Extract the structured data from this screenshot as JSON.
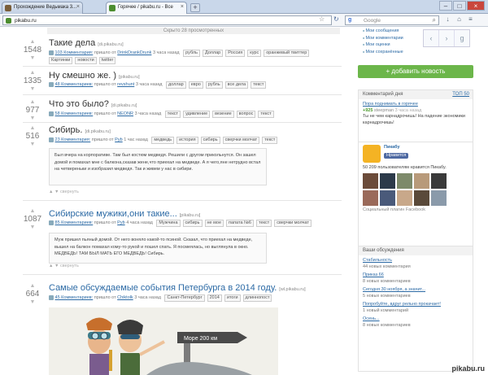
{
  "browser": {
    "tabs": [
      {
        "title": "Прохождение Ведьмака 3...",
        "active": false
      },
      {
        "title": "Горячее / pikabu.ru - Все",
        "active": true
      }
    ],
    "url": "pikabu.ru",
    "search_placeholder": "Google"
  },
  "page": {
    "top_strip": "Скрыто 28 просмотренных",
    "posts": [
      {
        "rating": "1548",
        "title": "Такие дела",
        "domain": "[di.pikabu.ru]",
        "comments": "103 Комментария:",
        "meta": "пришло от",
        "author": "DrinkDrankDrunk",
        "time": "3 часа назад",
        "tags": [
          "рубль",
          "Доллар",
          "Россия",
          "курс",
          "оранжевый твиттер"
        ],
        "tags2": [
          "Картинки",
          "новости",
          "twitter"
        ]
      },
      {
        "rating": "1335",
        "title": "Ну смешно же. )",
        "domain": "[pikabu.ru]",
        "comments": "48 Комментариев:",
        "meta": "пришло от",
        "author": "revshunt",
        "time": "3 часа назад",
        "tags": [
          "доллар",
          "евро",
          "рубль",
          "все дела",
          "текст"
        ]
      },
      {
        "rating": "977",
        "title": "Что это было?",
        "domain": "[di.pikabu.ru]",
        "comments": "58 Комментариев:",
        "meta": "пришло от",
        "author": "NEONR",
        "time": "3 часа назад",
        "tags": [
          "текст",
          "удивление",
          "везение",
          "вопрос",
          "текст"
        ]
      },
      {
        "rating": "516",
        "title": "Сибирь.",
        "domain": "[di.pikabu.ru]",
        "comments": "23 Комментария:",
        "meta": "пришло от",
        "author": "Pyb",
        "time": "1 час назад",
        "tags": [
          "медведь",
          "история",
          "сибирь",
          "сверчки молчат",
          "текст"
        ],
        "text": "Был вчера на корпоративе. Там был костюм медведя. Решили с другом прикольнутся. Он зашел домой и помахал мне с балкона,сказав жене,что приехал на медведе. А я чего,яне нетрудно встал на четвереньки и изобразил медведя. Так и живем у нас в сибири.",
        "collapse": "свернуть"
      },
      {
        "rating": "1087",
        "title": "Сибирские мужики,они такие...",
        "domain": "[pikabu.ru]",
        "comments": "85 Комментариев:",
        "meta": "пришло от",
        "author": "Pyb",
        "time": "4 часа назад",
        "tags": [
          "Мужчина",
          "сибирь",
          "не мое",
          "папата №6",
          "текст",
          "сверчки молчат"
        ],
        "text": "Муж пришел пьяный домой. От него воняло какой-то псиной. Сказал, что приехал на медведе, вышел на балкон помахал кому-то рукой и пошел спать. Я посмеялась, но выглянула в окно. МЕДВЕДЬ! ТАМ БЫЛ МАТЬ ЕГО МЕДВЕДЬ! Сибирь.",
        "collapse": "свернуть"
      },
      {
        "rating": "664",
        "title": "Самые обсуждаемые события Петербурга в 2014 году.",
        "domain": "[wl.pikabu.ru]",
        "comments": "45 Комментариев:",
        "meta": "пришло от",
        "author": "Chiktolk",
        "time": "3 часа назад",
        "tags": [
          "Санкт-Петербург",
          "2014",
          "итоги",
          "длиннопост"
        ],
        "image_sign": "Море 200 км"
      }
    ]
  },
  "sidebar": {
    "popup_links": [
      "Мои сообщения",
      "Мои комментарии",
      "Мои оценки",
      "Мои сохранённые"
    ],
    "add_button": "+ добавить новость",
    "comment_day": {
      "title": "Комментарий дня",
      "top": "ТОП 50",
      "link": "Пора поднимать в горячее",
      "score": "+925",
      "user": "steepman",
      "time": "3 часа назад",
      "text": "Ты не чем карнадрочишь! На падение экономики карнадрочишь!"
    },
    "fb": {
      "name": "Пикабу",
      "like": "Нравится",
      "count": "50 209 пользователям нравится Пикабу.",
      "plugin": "Социальный плагин Facebook"
    },
    "discussions": {
      "title": "Ваши обсуждения",
      "items": [
        {
          "title": "Стабильность",
          "sub": "44 новых комментария"
        },
        {
          "title": "Приказ 66",
          "sub": "8 новых комментариев"
        },
        {
          "title": "Сегодня 30 ноября, а значит...",
          "sub": "5 новых комментариев"
        },
        {
          "title": "Попробуйте, вдруг рельно прокачает!",
          "sub": "1 новый комментарий"
        },
        {
          "title": "Осень...",
          "sub": "8 новых комментариев"
        }
      ]
    }
  },
  "watermark": "pikabu.ru",
  "colors": {
    "accent": "#2c6aa5",
    "add_button": "#6cb64a"
  }
}
